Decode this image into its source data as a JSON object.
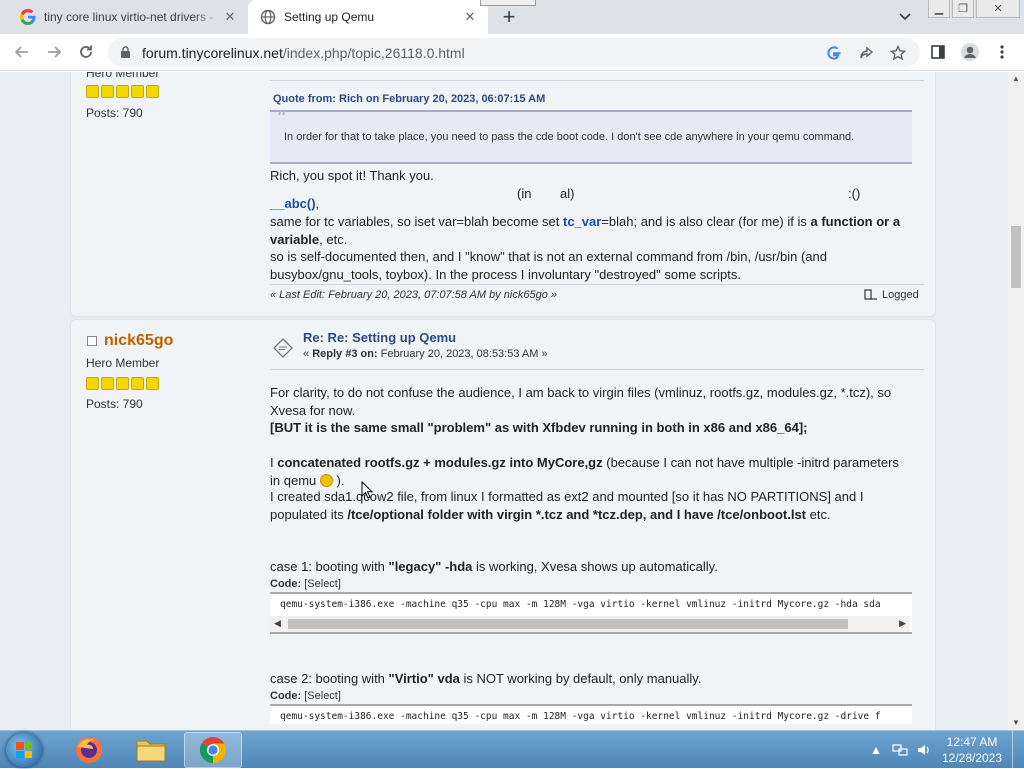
{
  "browser": {
    "tabs": [
      {
        "title": "tiny core linux virtio-net drivers -",
        "active": false
      },
      {
        "title": "Setting up Qemu",
        "active": true
      }
    ],
    "url_domain": "forum.tinycorelinux.net",
    "url_path": "/index.php/topic,26118.0.html"
  },
  "post1": {
    "rank": "Hero Member",
    "posts": "Posts: 790",
    "quote_header": "Quote from: Rich on February 20, 2023, 06:07:15 AM",
    "quote_text": "In order for that to take place, you need to pass the  cde  boot code. I don't see  cde  anywhere in your  qemu command.",
    "reply_line": "Rich, you spot it! Thank you.",
    "frag_a": "(in",
    "frag_b": "al)",
    "frag_c": ":()",
    "fn_name": "__abc()",
    "fn_tail": ",",
    "line2a": "same for tc variables, so iset var=blah become set ",
    "line2_var": "tc_var",
    "line2b": "=blah; and is also clear (for me) if is ",
    "line2_bold": "a function or a variable",
    "line2c": ", etc.",
    "line3": "so is self-documented then, and I \"know\" that is not an external command from /bin, /usr/bin (and busybox/gnu_tools, toybox). In the process I involuntary \"destroyed\" some scripts.",
    "last_edit": "« Last Edit: February 20, 2023, 07:07:58 AM by nick65go »",
    "logged": "Logged"
  },
  "post2": {
    "author": "nick65go",
    "rank": "Hero Member",
    "posts": "Posts: 790",
    "subject": "Re: Re: Setting up Qemu",
    "reply_prefix": "« ",
    "reply_bold": "Reply #3 on:",
    "reply_date": " February 20, 2023, 08:53:53 AM »",
    "p1": "For clarity, to do not confuse the audience, I am back to virgin files (vmlinuz, rootfs.gz, modules.gz, *.tcz), so Xvesa for now.",
    "p1_bold": "[BUT it is the same small \"problem\" as with Xfbdev running in both in x86 and x86_64];",
    "p2a": "I ",
    "p2_bold": "concatenated rootfs.gz + modules.gz into MyCore,gz",
    "p2b": " (because I can not have multiple -initrd parameters in qemu ",
    "p2c": " ).",
    "p3a": "I created sda1.qcow2 file, from linux I formatted as ext2 and mounted [so it has NO PARTITIONS] and I populated its ",
    "p3_bold": "/tce/optional folder with virgin *.tcz and *tcz.dep, and I have /tce/onboot.lst",
    "p3b": " etc.",
    "case1a": "case 1: booting with ",
    "case1_bold": "\"legacy\" -hda",
    "case1b": " is working, Xvesa shows up automatically.",
    "code_label": "Code: ",
    "select_label": "[Select]",
    "code1": "qemu-system-i386.exe -machine q35 -cpu max -m 128M -vga virtio -kernel vmlinuz -initrd Mycore.gz -hda sda",
    "case2a": "case 2: booting with ",
    "case2_bold": "\"Virtio\" vda",
    "case2b": " is NOT working by default, only manually.",
    "code2": "qemu-system-i386.exe -machine q35 -cpu max -m 128M -vga virtio -kernel vmlinuz -initrd Mycore.gz -drive f"
  },
  "taskbar": {
    "time": "12:47 AM",
    "date": "12/28/2023"
  }
}
